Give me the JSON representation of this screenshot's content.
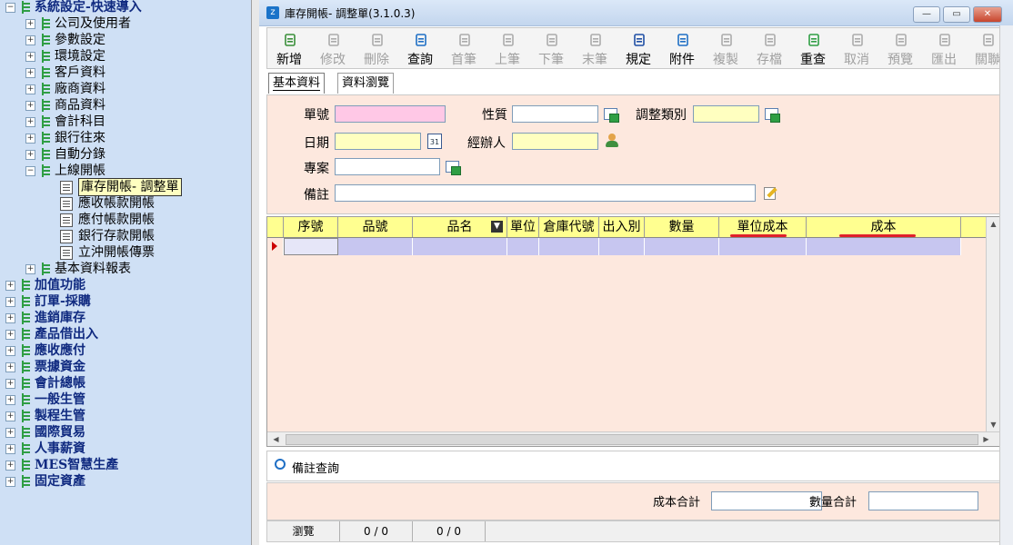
{
  "tree": {
    "items": [
      {
        "label": "系統設定-快速導入",
        "level": 0,
        "bold": true,
        "expander": "−"
      },
      {
        "label": "公司及使用者",
        "level": 1,
        "expander": "+"
      },
      {
        "label": "參數設定",
        "level": 1,
        "expander": "+"
      },
      {
        "label": "環境設定",
        "level": 1,
        "expander": "+"
      },
      {
        "label": "客戶資料",
        "level": 1,
        "expander": "+"
      },
      {
        "label": "廠商資料",
        "level": 1,
        "expander": "+"
      },
      {
        "label": "商品資料",
        "level": 1,
        "expander": "+"
      },
      {
        "label": "會計科目",
        "level": 1,
        "expander": "+"
      },
      {
        "label": "銀行往來",
        "level": 1,
        "expander": "+"
      },
      {
        "label": "自動分錄",
        "level": 1,
        "expander": "+"
      },
      {
        "label": "上線開帳",
        "level": 1,
        "expander": "−"
      },
      {
        "label": "庫存開帳- 調整單",
        "level": 2,
        "selected": true
      },
      {
        "label": "應收帳款開帳",
        "level": 2
      },
      {
        "label": "應付帳款開帳",
        "level": 2
      },
      {
        "label": "銀行存款開帳",
        "level": 2
      },
      {
        "label": "立沖開帳傳票",
        "level": 2
      },
      {
        "label": "基本資料報表",
        "level": 1,
        "expander": "+"
      },
      {
        "label": "加值功能",
        "level": 0,
        "bold": true,
        "expander": "+"
      },
      {
        "label": "訂單-採購",
        "level": 0,
        "bold": true,
        "expander": "+"
      },
      {
        "label": "進銷庫存",
        "level": 0,
        "bold": true,
        "expander": "+"
      },
      {
        "label": "產品借出入",
        "level": 0,
        "bold": true,
        "expander": "+"
      },
      {
        "label": "應收應付",
        "level": 0,
        "bold": true,
        "expander": "+"
      },
      {
        "label": "票據資金",
        "level": 0,
        "bold": true,
        "expander": "+"
      },
      {
        "label": "會計總帳",
        "level": 0,
        "bold": true,
        "expander": "+"
      },
      {
        "label": "一般生管",
        "level": 0,
        "bold": true,
        "expander": "+"
      },
      {
        "label": "製程生管",
        "level": 0,
        "bold": true,
        "expander": "+"
      },
      {
        "label": "國際貿易",
        "level": 0,
        "bold": true,
        "expander": "+"
      },
      {
        "label": "人事薪資",
        "level": 0,
        "bold": true,
        "expander": "+"
      },
      {
        "label": "MES智慧生產",
        "level": 0,
        "bold": true,
        "expander": "+"
      },
      {
        "label": "固定資產",
        "level": 0,
        "bold": true,
        "expander": "+"
      }
    ]
  },
  "window": {
    "title": "庫存開帳- 調整單(3.1.0.3)",
    "app_icon": "z",
    "minimize": "—",
    "maximize": "▭",
    "close": "✕"
  },
  "toolbar": [
    {
      "label": "新增",
      "icon": "new-doc-icon",
      "enabled": true,
      "color": "#3a8f3a"
    },
    {
      "label": "修改",
      "icon": "edit-icon",
      "enabled": false,
      "color": "#555555"
    },
    {
      "label": "刪除",
      "icon": "trash-icon",
      "enabled": false,
      "color": "#555555"
    },
    {
      "label": "查詢",
      "icon": "search-icon",
      "enabled": true,
      "color": "#1f6fc5"
    },
    {
      "label": "首筆",
      "icon": "first-record-icon",
      "enabled": false,
      "color": "#555555"
    },
    {
      "label": "上筆",
      "icon": "prev-record-icon",
      "enabled": false,
      "color": "#555555"
    },
    {
      "label": "下筆",
      "icon": "next-record-icon",
      "enabled": false,
      "color": "#555555"
    },
    {
      "label": "末筆",
      "icon": "last-record-icon",
      "enabled": false,
      "color": "#555555"
    },
    {
      "label": "規定",
      "icon": "book-icon",
      "enabled": true,
      "color": "#1f4fa5"
    },
    {
      "label": "附件",
      "icon": "attachment-icon",
      "enabled": true,
      "color": "#1f6fc5"
    },
    {
      "label": "複製",
      "icon": "copy-icon",
      "enabled": false,
      "color": "#555555"
    },
    {
      "label": "存檔",
      "icon": "save-check-icon",
      "enabled": false,
      "color": "#555555"
    },
    {
      "label": "重查",
      "icon": "refresh-icon",
      "enabled": true,
      "color": "#2f9e44"
    },
    {
      "label": "取消",
      "icon": "cancel-icon",
      "enabled": false,
      "color": "#555555"
    },
    {
      "label": "預覽",
      "icon": "print-preview-icon",
      "enabled": false,
      "color": "#555555"
    },
    {
      "label": "匯出",
      "icon": "export-icon",
      "enabled": false,
      "color": "#555555"
    },
    {
      "label": "關聯",
      "icon": "link-icon",
      "enabled": false,
      "color": "#555555"
    }
  ],
  "tabs": [
    {
      "label": "基本資料",
      "active": true
    },
    {
      "label": "資料瀏覽",
      "active": false
    }
  ],
  "form": {
    "doc_no_label": "單號",
    "doc_no": "",
    "nature_label": "性質",
    "nature": "",
    "adjust_type_label": "調整類別",
    "adjust_type": "",
    "date_label": "日期",
    "date": "",
    "calendar_day": "31",
    "handler_label": "經辦人",
    "handler": "",
    "project_label": "專案",
    "project": "",
    "memo_label": "備註",
    "memo": ""
  },
  "grid": {
    "columns": [
      "序號",
      "品號",
      "品名",
      "單位",
      "倉庫代號",
      "出入別",
      "數量",
      "單位成本",
      "成本"
    ],
    "sort_icon": "▼",
    "highlight_color": "#e0202a"
  },
  "memo_query": {
    "label": "備註查詢"
  },
  "totals": {
    "cost_total_label": "成本合計",
    "cost_total": "",
    "qty_total_label": "數量合計",
    "qty_total": ""
  },
  "status": {
    "mode": "瀏覽",
    "count1": "0 / 0",
    "count2": "0 / 0"
  }
}
